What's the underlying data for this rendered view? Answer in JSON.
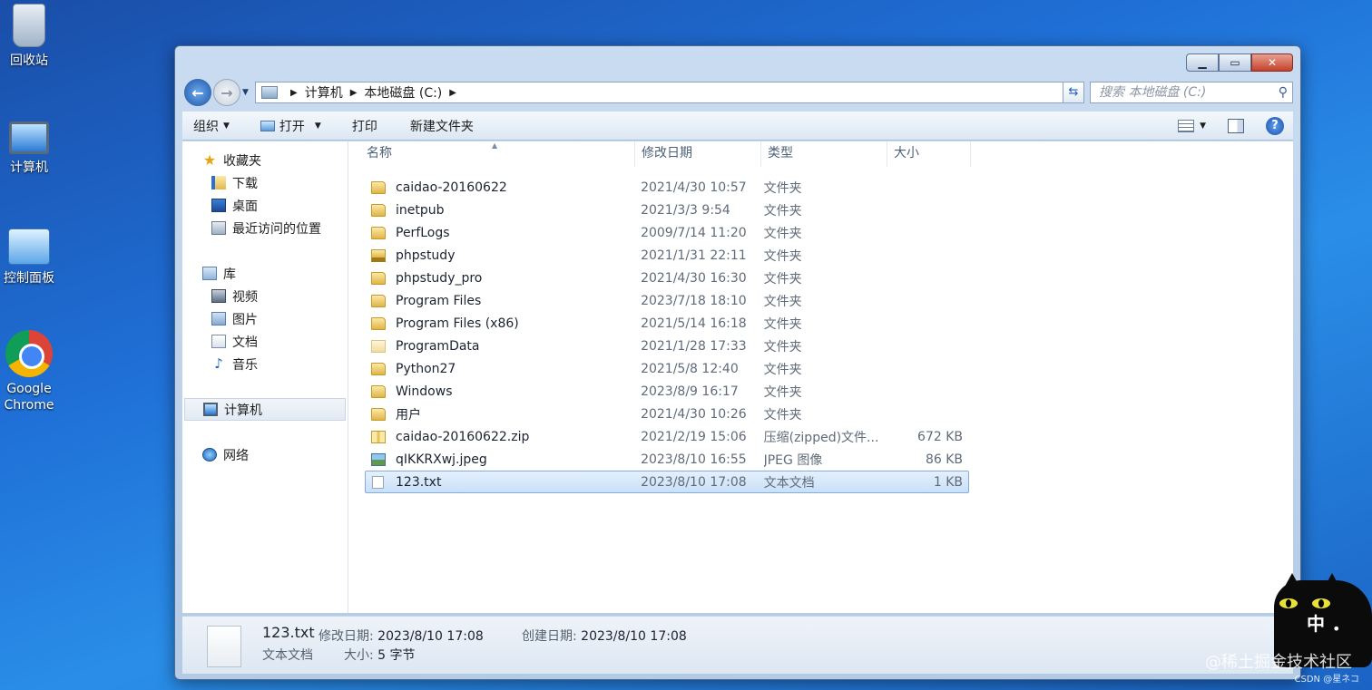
{
  "desktop": {
    "icons": [
      {
        "label": "回收站",
        "icon": "recycle-bin-icon"
      },
      {
        "label": "计算机",
        "icon": "computer-icon"
      },
      {
        "label": "控制面板",
        "icon": "control-panel-icon"
      },
      {
        "label": "Google Chrome",
        "icon": "chrome-icon"
      }
    ]
  },
  "window": {
    "caption": {
      "minimize": "▁",
      "maximize": "▭",
      "close": "✕"
    },
    "address": {
      "root": "计算机",
      "drive": "本地磁盘 (C:)"
    },
    "search_placeholder": "搜索 本地磁盘 (C:)",
    "toolbar": {
      "organize": "组织",
      "open": "打开",
      "print": "打印",
      "new_folder": "新建文件夹"
    },
    "navpane": {
      "favorites": "收藏夹",
      "downloads": "下载",
      "desktop": "桌面",
      "recent": "最近访问的位置",
      "libraries": "库",
      "videos": "视频",
      "pictures": "图片",
      "documents": "文档",
      "music": "音乐",
      "computer": "计算机",
      "network": "网络"
    },
    "columns": {
      "name": "名称",
      "date": "修改日期",
      "type": "类型",
      "size": "大小"
    },
    "files": [
      {
        "name": "caidao-20160622",
        "date": "2021/4/30 10:57",
        "type": "文件夹",
        "size": "",
        "icon": "folder-icon"
      },
      {
        "name": "inetpub",
        "date": "2021/3/3 9:54",
        "type": "文件夹",
        "size": "",
        "icon": "folder-icon"
      },
      {
        "name": "PerfLogs",
        "date": "2009/7/14 11:20",
        "type": "文件夹",
        "size": "",
        "icon": "folder-icon"
      },
      {
        "name": "phpstudy",
        "date": "2021/1/31 22:11",
        "type": "文件夹",
        "size": "",
        "icon": "locked-folder-icon"
      },
      {
        "name": "phpstudy_pro",
        "date": "2021/4/30 16:30",
        "type": "文件夹",
        "size": "",
        "icon": "folder-icon"
      },
      {
        "name": "Program Files",
        "date": "2023/7/18 18:10",
        "type": "文件夹",
        "size": "",
        "icon": "folder-icon"
      },
      {
        "name": "Program Files (x86)",
        "date": "2021/5/14 16:18",
        "type": "文件夹",
        "size": "",
        "icon": "folder-icon"
      },
      {
        "name": "ProgramData",
        "date": "2021/1/28 17:33",
        "type": "文件夹",
        "size": "",
        "icon": "hidden-folder-icon"
      },
      {
        "name": "Python27",
        "date": "2021/5/8 12:40",
        "type": "文件夹",
        "size": "",
        "icon": "folder-icon"
      },
      {
        "name": "Windows",
        "date": "2023/8/9 16:17",
        "type": "文件夹",
        "size": "",
        "icon": "folder-icon"
      },
      {
        "name": "用户",
        "date": "2021/4/30 10:26",
        "type": "文件夹",
        "size": "",
        "icon": "folder-icon"
      },
      {
        "name": "caidao-20160622.zip",
        "date": "2021/2/19 15:06",
        "type": "压缩(zipped)文件...",
        "size": "672 KB",
        "icon": "zip-file-icon"
      },
      {
        "name": "qIKKRXwj.jpeg",
        "date": "2023/8/10 16:55",
        "type": "JPEG 图像",
        "size": "86 KB",
        "icon": "image-file-icon"
      },
      {
        "name": "123.txt",
        "date": "2023/8/10 17:08",
        "type": "文本文档",
        "size": "1 KB",
        "icon": "text-file-icon",
        "selected": true
      }
    ],
    "details": {
      "name": "123.txt",
      "type": "文本文档",
      "modified_label": "修改日期:",
      "modified": "2023/8/10 17:08",
      "size_label": "大小:",
      "size": "5 字节",
      "created_label": "创建日期:",
      "created": "2023/8/10 17:08"
    }
  },
  "overlay": {
    "ime_char": "中",
    "ime_dot": "•",
    "watermark": "@稀土掘金技术社区",
    "watermark_small": "CSDN @星ネコ"
  }
}
